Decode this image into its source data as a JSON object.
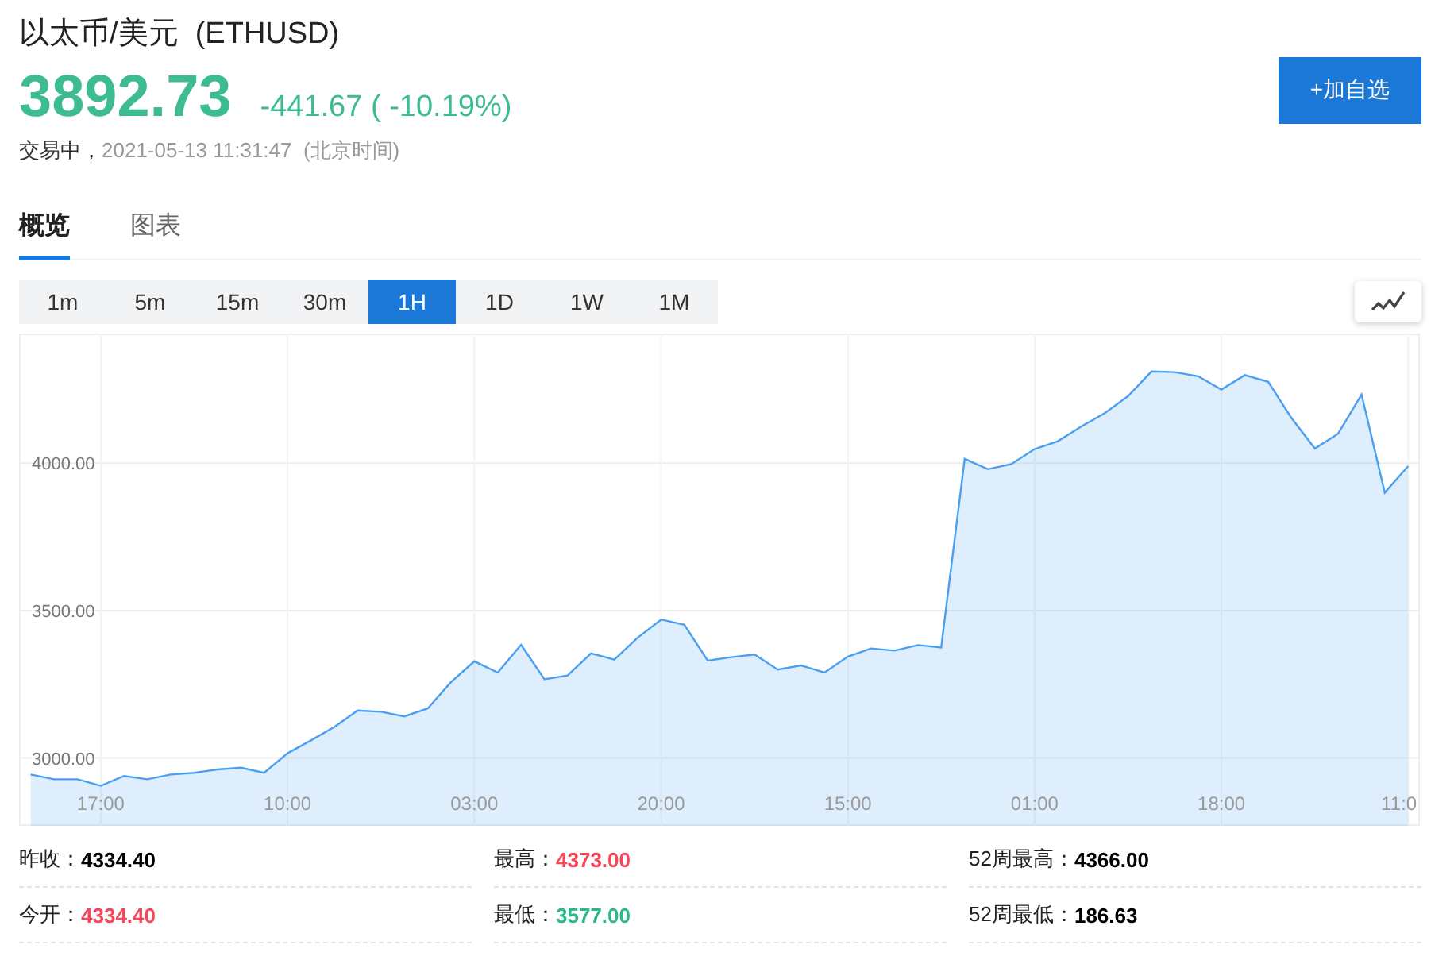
{
  "header": {
    "title": "以太币/美元  (ETHUSD)",
    "price": "3892.73",
    "change": "-441.67 ( -10.19%)",
    "status": "交易中，",
    "timestamp": "2021-05-13 11:31:47  (北京时间)",
    "add_button": "+加自选"
  },
  "tabs": [
    {
      "label": "概览",
      "selected": true
    },
    {
      "label": "图表",
      "selected": false
    }
  ],
  "intervals": [
    {
      "label": "1m",
      "selected": false
    },
    {
      "label": "5m",
      "selected": false
    },
    {
      "label": "15m",
      "selected": false
    },
    {
      "label": "30m",
      "selected": false
    },
    {
      "label": "1H",
      "selected": true
    },
    {
      "label": "1D",
      "selected": false
    },
    {
      "label": "1W",
      "selected": false
    },
    {
      "label": "1M",
      "selected": false
    }
  ],
  "chart_data": {
    "type": "area",
    "grid": true,
    "ylim": [
      2770,
      4440
    ],
    "yticks": [
      {
        "value": 3000,
        "label": "3000.00"
      },
      {
        "value": 3500,
        "label": "3500.00"
      },
      {
        "value": 4000,
        "label": "4000.00"
      }
    ],
    "categories": [
      null,
      null,
      null,
      "17:00",
      null,
      null,
      null,
      null,
      null,
      null,
      null,
      "10:00",
      null,
      null,
      null,
      null,
      null,
      null,
      null,
      "03:00",
      null,
      null,
      null,
      null,
      null,
      null,
      null,
      "20:00",
      null,
      null,
      null,
      null,
      null,
      null,
      null,
      "15:00",
      null,
      null,
      null,
      null,
      null,
      null,
      null,
      "01:00",
      null,
      null,
      null,
      null,
      null,
      null,
      null,
      "18:00",
      null,
      null,
      null,
      null,
      null,
      null,
      null,
      "11:0"
    ],
    "series": [
      {
        "color": "#4a9ff0",
        "values": [
          2944,
          2928,
          2928,
          2906,
          2939,
          2928,
          2944,
          2950,
          2961,
          2967,
          2950,
          3016,
          3060,
          3105,
          3161,
          3157,
          3141,
          3168,
          3257,
          3328,
          3290,
          3384,
          3267,
          3280,
          3355,
          3334,
          3409,
          3470,
          3452,
          3330,
          3342,
          3351,
          3300,
          3314,
          3290,
          3344,
          3372,
          3364,
          3383,
          3375,
          4015,
          3980,
          3997,
          4048,
          4075,
          4125,
          4170,
          4228,
          4311,
          4309,
          4295,
          4250,
          4299,
          4276,
          4154,
          4050,
          4100,
          4233,
          3900,
          3990
        ]
      }
    ]
  },
  "stats": [
    {
      "label": "昨收：",
      "value": "4334.40",
      "color": "#000000"
    },
    {
      "label": "最高：",
      "value": "4373.00",
      "color": "#f5475a"
    },
    {
      "label": "52周最高：",
      "value": "4366.00",
      "color": "#000000"
    },
    {
      "label": "今开：",
      "value": "4334.40",
      "color": "#f5475a"
    },
    {
      "label": "最低：",
      "value": "3577.00",
      "color": "#2db78d"
    },
    {
      "label": "52周最低：",
      "value": "186.63",
      "color": "#000000"
    }
  ]
}
